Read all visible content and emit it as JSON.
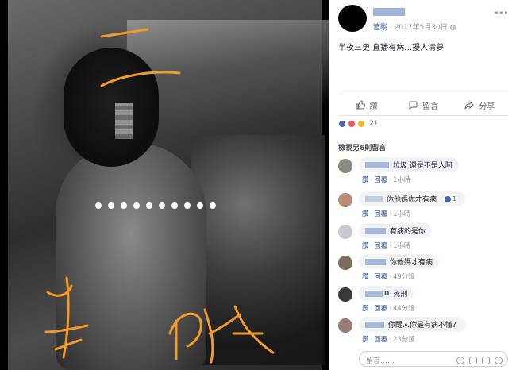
{
  "post": {
    "follow_label": "追蹤",
    "date": "2017年5月30日",
    "privacy_icon": "globe-icon",
    "text": "半夜三更 直播有病…擾人清夢"
  },
  "actions": {
    "like": "讚",
    "comment": "留言",
    "share": "分享"
  },
  "reactions": {
    "types": [
      "like",
      "love",
      "haha"
    ],
    "count": "21"
  },
  "view_more": "檢視另6則留言",
  "comments": [
    {
      "text": "垃圾 還是不是人阿",
      "like": "讚",
      "reply": "回覆",
      "time": "1小時",
      "avatar_color": "#8a8a80"
    },
    {
      "text": "你他媽你才有病",
      "like": "讚",
      "reply": "回覆",
      "time": "1小時",
      "avatar_color": "#b98a78",
      "badge": "1"
    },
    {
      "text": "有病的是你",
      "like": "讚",
      "reply": "回覆",
      "time": "1小時",
      "avatar_color": "#c8c8d0"
    },
    {
      "text": "你他媽才有病",
      "like": "讚",
      "reply": "回覆",
      "time": "49分鐘",
      "avatar_color": "#7a6e58"
    },
    {
      "name_suffix": "u",
      "text": "死刑",
      "like": "讚",
      "reply": "回覆",
      "time": "44分鐘",
      "avatar_color": "#3a3a3a"
    },
    {
      "text": "你醒人你最有病不懂？",
      "like": "讚",
      "reply": "回覆",
      "time": "23分鐘",
      "avatar_color": "#9a7b78"
    }
  ],
  "composer": {
    "placeholder": "留言……"
  },
  "colors": {
    "link": "#385898",
    "scribble": "#f39a2a"
  }
}
